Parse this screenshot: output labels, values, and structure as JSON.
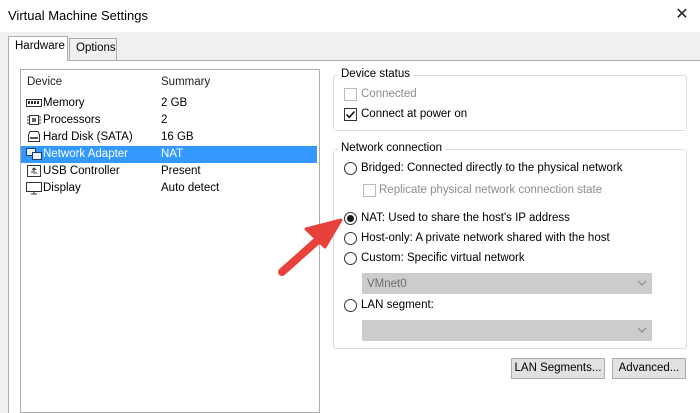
{
  "window": {
    "title": "Virtual Machine Settings",
    "close_glyph": "✕"
  },
  "tabs": [
    {
      "label": "Hardware",
      "active": true
    },
    {
      "label": "Options",
      "active": false
    }
  ],
  "device_list": {
    "columns": [
      "Device",
      "Summary"
    ],
    "rows": [
      {
        "device": "Memory",
        "summary": "2 GB",
        "icon": "memory-icon"
      },
      {
        "device": "Processors",
        "summary": "2",
        "icon": "processor-icon"
      },
      {
        "device": "Hard Disk (SATA)",
        "summary": "16 GB",
        "icon": "hard-disk-icon"
      },
      {
        "device": "Network Adapter",
        "summary": "NAT",
        "icon": "network-adapter-icon",
        "selected": true
      },
      {
        "device": "USB Controller",
        "summary": "Present",
        "icon": "usb-icon"
      },
      {
        "device": "Display",
        "summary": "Auto detect",
        "icon": "display-icon"
      }
    ]
  },
  "device_status": {
    "title": "Device status",
    "connected": {
      "label": "Connected",
      "checked": false,
      "enabled": false
    },
    "connect_at_power_on": {
      "label": "Connect at power on",
      "checked": true,
      "enabled": true
    }
  },
  "network_connection": {
    "title": "Network connection",
    "bridged": "Bridged: Connected directly to the physical network",
    "replicate": "Replicate physical network connection state",
    "nat": "NAT: Used to share the host's IP address",
    "host_only": "Host-only: A private network shared with the host",
    "custom": "Custom: Specific virtual network",
    "custom_value": "VMnet0",
    "lan_segment": "LAN segment:",
    "lan_segment_value": "",
    "selected": "nat"
  },
  "buttons": {
    "lan_segments": "LAN Segments...",
    "advanced": "Advanced..."
  },
  "colors": {
    "selection": "#3399ff",
    "annotation_arrow": "#e8413c"
  }
}
